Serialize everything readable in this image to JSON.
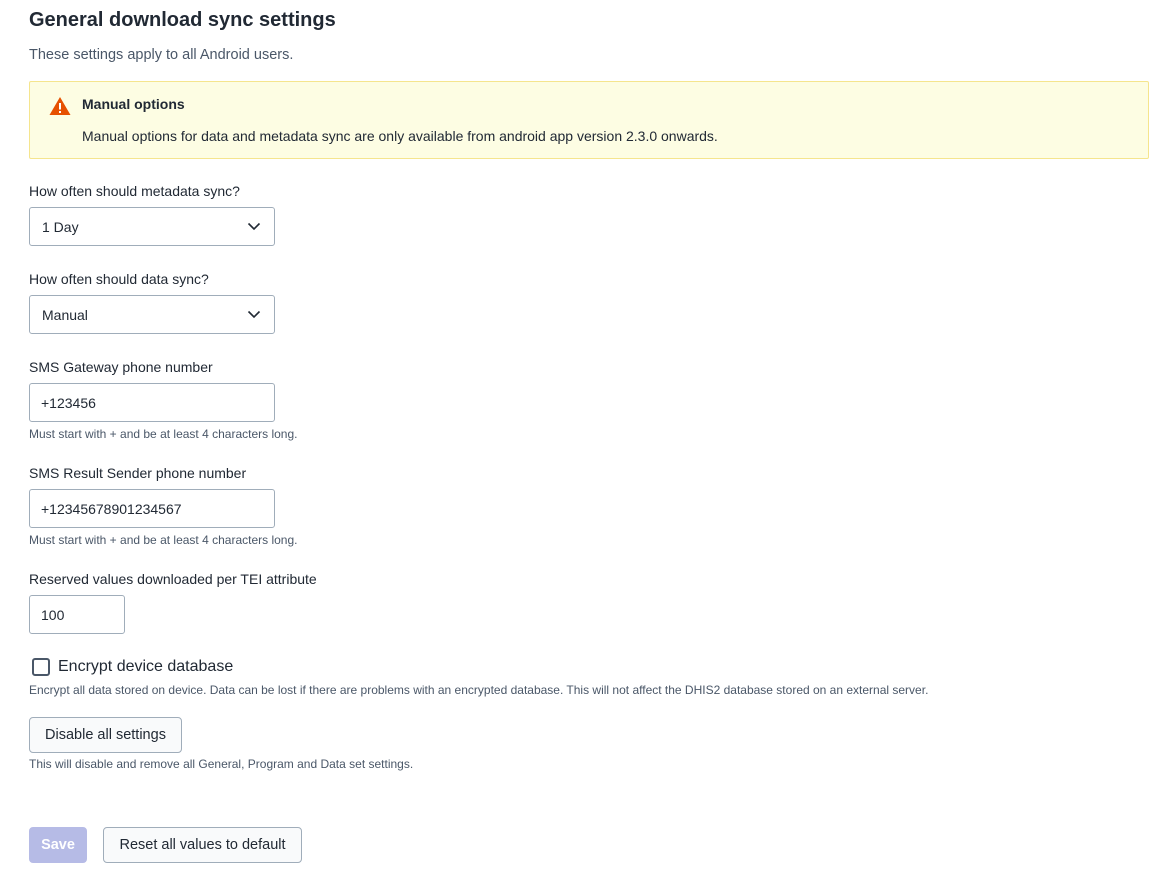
{
  "header": {
    "title": "General download sync settings",
    "subtitle": "These settings apply to all Android users."
  },
  "notice": {
    "icon": "warning-icon",
    "color": "#e65100",
    "title": "Manual options",
    "body": "Manual options for data and metadata sync are only available from android app version 2.3.0 onwards."
  },
  "metadata_sync": {
    "label": "How often should metadata sync?",
    "value": "1 Day"
  },
  "data_sync": {
    "label": "How often should data sync?",
    "value": "Manual"
  },
  "sms_gateway": {
    "label": "SMS Gateway phone number",
    "value": "+123456",
    "help": "Must start with + and be at least 4 characters long."
  },
  "sms_result_sender": {
    "label": "SMS Result Sender phone number",
    "value": "+12345678901234567",
    "help": "Must start with + and be at least 4 characters long."
  },
  "reserved_values": {
    "label": "Reserved values downloaded per TEI attribute",
    "value": "100"
  },
  "encrypt_db": {
    "label": "Encrypt device database",
    "checked": false,
    "help": "Encrypt all data stored on device. Data can be lost if there are problems with an encrypted database. This will not affect the DHIS2 database stored on an external server."
  },
  "disable_all": {
    "label": "Disable all settings",
    "help": "This will disable and remove all General, Program and Data set settings."
  },
  "footer": {
    "save_label": "Save",
    "reset_label": "Reset all values to default"
  }
}
